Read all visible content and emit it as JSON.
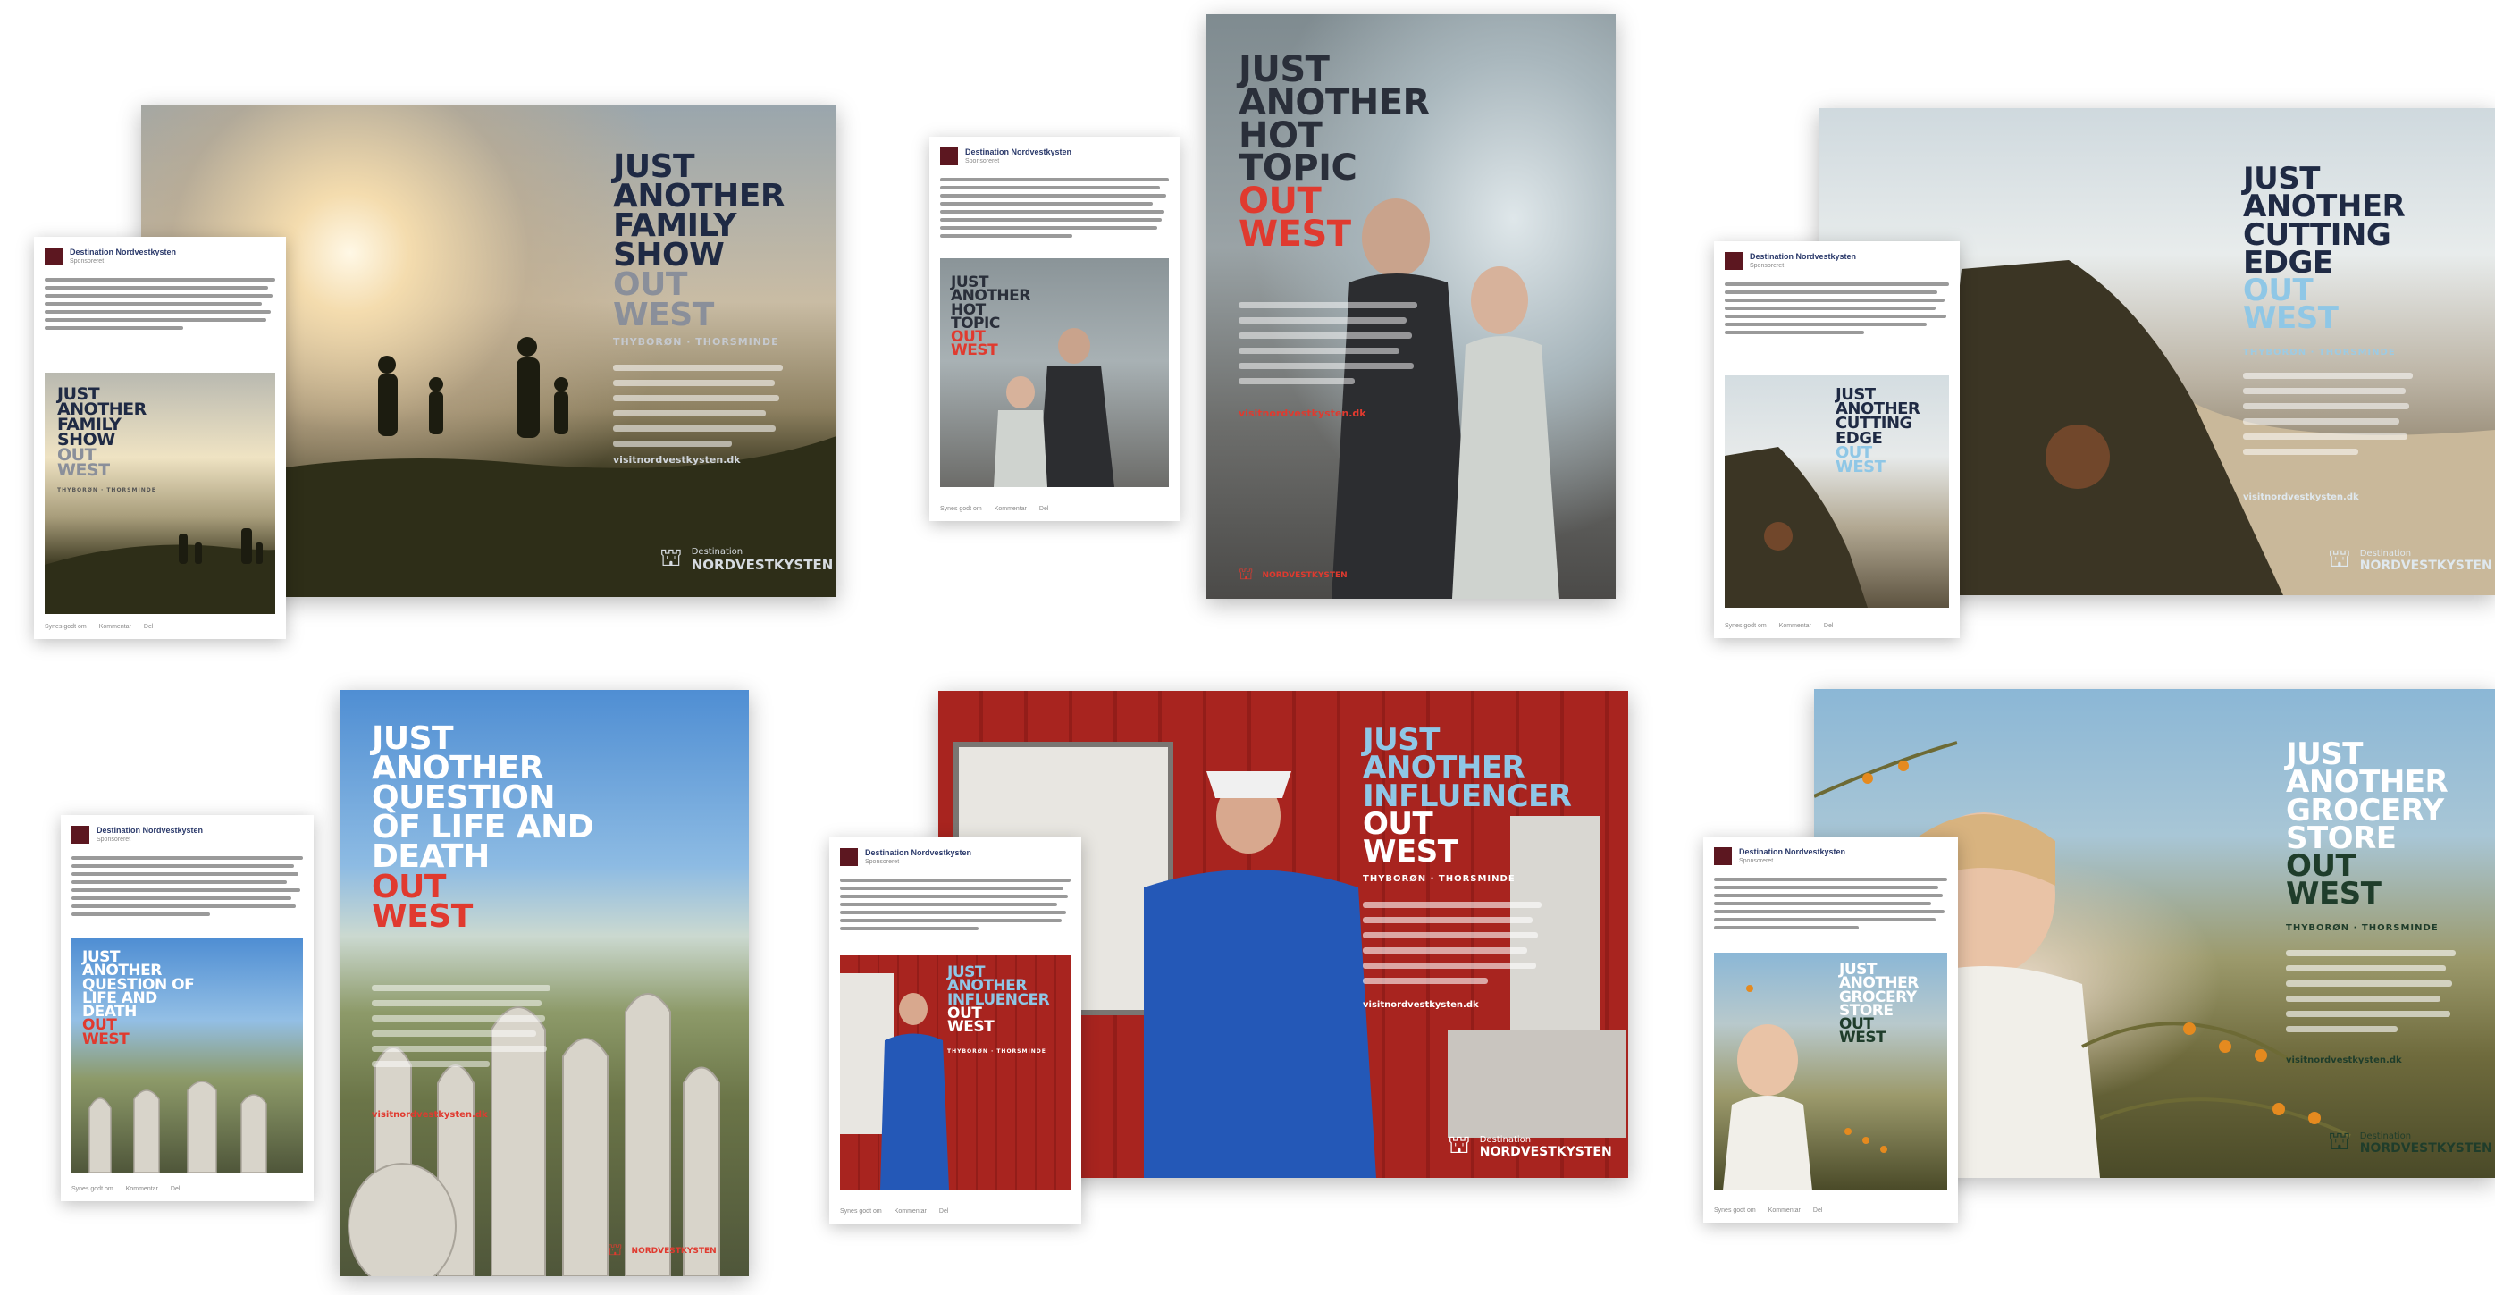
{
  "colors": {
    "navy": "#1f2a44",
    "red": "#e03a2f",
    "lightblue": "#8fc7e6",
    "white": "#ffffff",
    "darkgreen": "#1f3d2b"
  },
  "ads": [
    {
      "poster": {
        "lines": [
          "JUST",
          "ANOTHER",
          "FAMILY",
          "SHOW"
        ],
        "outwest": [
          "OUT",
          "WEST"
        ],
        "subtitle": "THYBORØN · THORSMINDE",
        "url": "visitnordvestkysten.dk",
        "logo": "NORDVESTKYSTEN",
        "logo_small": "Destination"
      },
      "card": {
        "page": "Destination Nordvestkysten",
        "sponsored": "Sponsoreret",
        "lines": [
          "JUST",
          "ANOTHER",
          "FAMILY",
          "SHOW"
        ],
        "outwest": [
          "OUT",
          "WEST"
        ],
        "sub": "THYBORØN · THORSMINDE",
        "foot": [
          "Synes godt om",
          "Kommentar",
          "Del"
        ]
      }
    },
    {
      "poster": {
        "lines": [
          "JUST",
          "ANOTHER",
          "HOT",
          "TOPIC"
        ],
        "outwest": [
          "OUT",
          "WEST"
        ],
        "url": "visitnordvestkysten.dk",
        "logo": "NORDVESTKYSTEN"
      },
      "card": {
        "page": "Destination Nordvestkysten",
        "sponsored": "Sponsoreret",
        "lines": [
          "JUST",
          "ANOTHER",
          "HOT",
          "TOPIC"
        ],
        "outwest": [
          "OUT",
          "WEST"
        ],
        "foot": [
          "Synes godt om",
          "Kommentar",
          "Del"
        ]
      }
    },
    {
      "poster": {
        "lines": [
          "JUST",
          "ANOTHER",
          "CUTTING",
          "EDGE"
        ],
        "outwest": [
          "OUT",
          "WEST"
        ],
        "subtitle": "THYBORØN · THORSMINDE",
        "url": "visitnordvestkysten.dk",
        "logo": "NORDVESTKYSTEN",
        "logo_small": "Destination"
      },
      "card": {
        "page": "Destination Nordvestkysten",
        "sponsored": "Sponsoreret",
        "lines": [
          "JUST",
          "ANOTHER",
          "CUTTING",
          "EDGE"
        ],
        "outwest": [
          "OUT",
          "WEST"
        ],
        "foot": [
          "Synes godt om",
          "Kommentar",
          "Del"
        ]
      }
    },
    {
      "poster": {
        "lines": [
          "JUST",
          "ANOTHER",
          "QUESTION",
          "OF LIFE AND",
          "DEATH"
        ],
        "outwest": [
          "OUT",
          "WEST"
        ],
        "url": "visitnordvestkysten.dk",
        "logo": "NORDVESTKYSTEN"
      },
      "card": {
        "page": "Destination Nordvestkysten",
        "sponsored": "Sponsoreret",
        "lines": [
          "JUST",
          "ANOTHER",
          "QUESTION OF",
          "LIFE AND",
          "DEATH"
        ],
        "outwest": [
          "OUT",
          "WEST"
        ],
        "foot": [
          "Synes godt om",
          "Kommentar",
          "Del"
        ]
      }
    },
    {
      "poster": {
        "lines": [
          "JUST",
          "ANOTHER",
          "INFLUENCER"
        ],
        "outwest": [
          "OUT",
          "WEST"
        ],
        "subtitle": "THYBORØN · THORSMINDE",
        "url": "visitnordvestkysten.dk",
        "logo": "NORDVESTKYSTEN",
        "logo_small": "Destination"
      },
      "card": {
        "page": "Destination Nordvestkysten",
        "sponsored": "Sponsoreret",
        "lines": [
          "JUST",
          "ANOTHER",
          "INFLUENCER"
        ],
        "outwest": [
          "OUT",
          "WEST"
        ],
        "sub": "THYBORØN · THORSMINDE",
        "foot": [
          "Synes godt om",
          "Kommentar",
          "Del"
        ]
      }
    },
    {
      "poster": {
        "lines": [
          "JUST",
          "ANOTHER",
          "GROCERY",
          "STORE"
        ],
        "outwest": [
          "OUT",
          "WEST"
        ],
        "subtitle": "THYBORØN · THORSMINDE",
        "url": "visitnordvestkysten.dk",
        "logo": "NORDVESTKYSTEN",
        "logo_small": "Destination"
      },
      "card": {
        "page": "Destination Nordvestkysten",
        "sponsored": "Sponsoreret",
        "lines": [
          "JUST",
          "ANOTHER",
          "GROCERY",
          "STORE"
        ],
        "outwest": [
          "OUT",
          "WEST"
        ],
        "foot": [
          "Synes godt om",
          "Kommentar",
          "Del"
        ]
      }
    }
  ]
}
